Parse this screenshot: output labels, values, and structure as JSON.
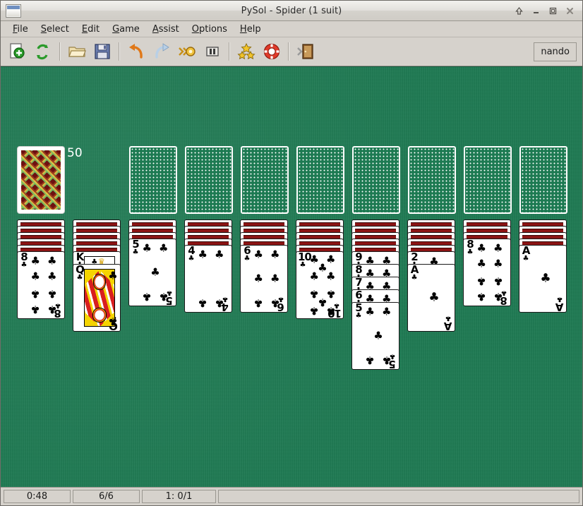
{
  "window": {
    "title": "PySol - Spider (1 suit)",
    "icon": "window-icon",
    "buttons": [
      {
        "name": "shade-button",
        "glyph": "⇧"
      },
      {
        "name": "minimize-button",
        "glyph": "–"
      },
      {
        "name": "maximize-button",
        "glyph": "□"
      },
      {
        "name": "close-button",
        "glyph": "✕"
      }
    ]
  },
  "menubar": {
    "items": [
      {
        "mnemonic": "F",
        "rest": "ile"
      },
      {
        "mnemonic": "S",
        "rest": "elect"
      },
      {
        "mnemonic": "E",
        "rest": "dit"
      },
      {
        "mnemonic": "G",
        "rest": "ame"
      },
      {
        "mnemonic": "A",
        "rest": "ssist"
      },
      {
        "mnemonic": "O",
        "rest": "ptions"
      },
      {
        "mnemonic": "H",
        "rest": "elp"
      }
    ]
  },
  "toolbar": {
    "buttons": [
      {
        "name": "new-game-icon",
        "label": "New"
      },
      {
        "name": "restart-game-icon",
        "label": "Restart"
      },
      {
        "name": "open-game-icon",
        "label": "Open"
      },
      {
        "name": "save-game-icon",
        "label": "Save"
      },
      {
        "name": "undo-icon",
        "label": "Undo"
      },
      {
        "name": "redo-icon",
        "label": "Redo"
      },
      {
        "name": "autodrop-icon",
        "label": "Autodrop"
      },
      {
        "name": "pause-icon",
        "label": "Pause"
      },
      {
        "name": "statistics-icon",
        "label": "Statistics"
      },
      {
        "name": "rules-icon",
        "label": "Rules"
      },
      {
        "name": "quit-icon",
        "label": "Quit"
      }
    ],
    "player_name": "nando"
  },
  "game": {
    "suit_symbol": "♣",
    "stock": {
      "count_label": "50",
      "face_down": true
    },
    "foundations": [
      {
        "name": "foundation-1"
      },
      {
        "name": "foundation-2"
      },
      {
        "name": "foundation-3"
      },
      {
        "name": "foundation-4"
      },
      {
        "name": "foundation-5"
      },
      {
        "name": "foundation-6"
      },
      {
        "name": "foundation-7"
      },
      {
        "name": "foundation-8"
      }
    ],
    "tableau": [
      {
        "name": "tableau-column-1",
        "face_down": 5,
        "face_up": [
          {
            "rank": "8",
            "suit": "♣",
            "pips": 8
          }
        ]
      },
      {
        "name": "tableau-column-2",
        "face_down": 5,
        "face_up": [
          {
            "rank": "K",
            "suit": "♣",
            "court": true
          },
          {
            "rank": "Q",
            "suit": "♣",
            "court": true
          }
        ]
      },
      {
        "name": "tableau-column-3",
        "face_down": 3,
        "face_up": [
          {
            "rank": "5",
            "suit": "♣",
            "pips": 5
          }
        ]
      },
      {
        "name": "tableau-column-4",
        "face_down": 4,
        "face_up": [
          {
            "rank": "4",
            "suit": "♣",
            "pips": 4
          }
        ]
      },
      {
        "name": "tableau-column-5",
        "face_down": 4,
        "face_up": [
          {
            "rank": "6",
            "suit": "♣",
            "pips": 6
          }
        ]
      },
      {
        "name": "tableau-column-6",
        "face_down": 5,
        "face_up": [
          {
            "rank": "10",
            "suit": "♣",
            "pips": 10
          }
        ]
      },
      {
        "name": "tableau-column-7",
        "face_down": 5,
        "face_up": [
          {
            "rank": "9",
            "suit": "♣",
            "pips": 9
          },
          {
            "rank": "8",
            "suit": "♣",
            "pips": 8
          },
          {
            "rank": "7",
            "suit": "♣",
            "pips": 7
          },
          {
            "rank": "6",
            "suit": "♣",
            "pips": 6
          },
          {
            "rank": "5",
            "suit": "♣",
            "pips": 5
          }
        ]
      },
      {
        "name": "tableau-column-8",
        "face_down": 5,
        "face_up": [
          {
            "rank": "2",
            "suit": "♣",
            "pips": 2
          },
          {
            "rank": "A",
            "suit": "♣",
            "pips": 1
          }
        ]
      },
      {
        "name": "tableau-column-9",
        "face_down": 3,
        "face_up": [
          {
            "rank": "8",
            "suit": "♣",
            "pips": 8
          }
        ]
      },
      {
        "name": "tableau-column-10",
        "face_down": 4,
        "face_up": [
          {
            "rank": "A",
            "suit": "♣",
            "pips": 1
          }
        ]
      }
    ]
  },
  "statusbar": {
    "time": "0:48",
    "moves": "6/6",
    "stats": "1: 0/1",
    "info": ""
  },
  "colors": {
    "table_green": "#1d7a52",
    "card_back_red": "#6e1010",
    "chrome_gray": "#d6d2cc",
    "text_black": "#1b1b1b"
  }
}
